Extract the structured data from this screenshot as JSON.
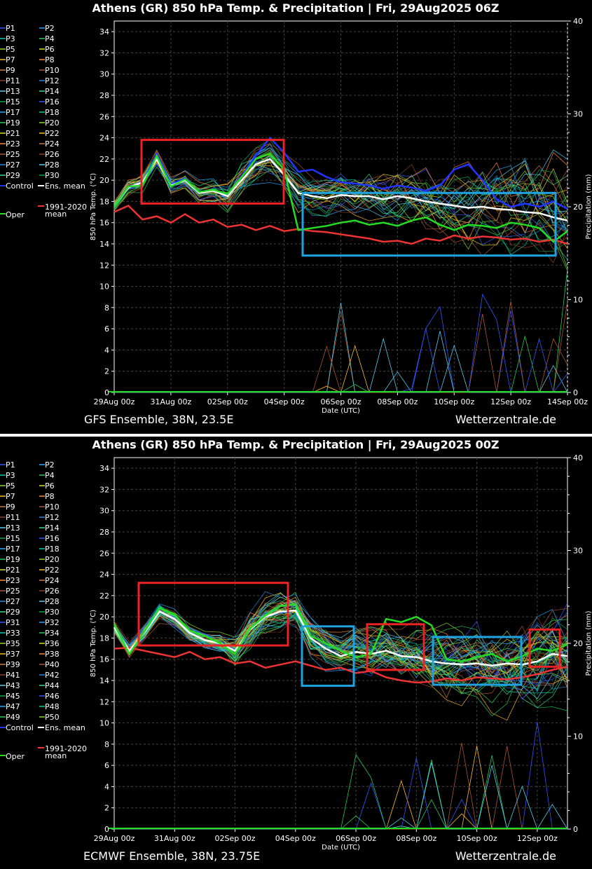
{
  "charts": [
    {
      "title": "Athens  (GR)  850 hPa Temp. & Precipitation | Fri, 29Aug2025 06Z",
      "footer_left": "GFS Ensemble, 38N, 23.5E",
      "footer_right": "Wetterzentrale.de",
      "members": 30,
      "legend_extra": [
        "Control",
        "Ens. mean",
        "1991-2020",
        "mean",
        "Oper"
      ],
      "ylabel": "850 hPa Temp. (°C)",
      "ylabel2": "Precipitation (mm)",
      "xlabel": "Date (UTC)",
      "x_ticks": [
        "29Aug 00z",
        "31Aug 00z",
        "02Sep 00z",
        "04Sep 00z",
        "06Sep 00z",
        "08Sep 00z",
        "10Sep 00z",
        "12Sep 00z",
        "14Sep 00z"
      ],
      "y_ticks": [
        0,
        2,
        4,
        6,
        8,
        10,
        12,
        14,
        16,
        18,
        20,
        22,
        24,
        26,
        28,
        30,
        32,
        34
      ],
      "y2_ticks": [
        0,
        10,
        20,
        30,
        40
      ],
      "ylim": [
        0,
        35
      ],
      "y2lim": [
        0,
        40
      ],
      "days_span": 16
    },
    {
      "title": "Athens  (GR)  850 hPa Temp. & Precipitation | Fri, 29Aug2025 00Z",
      "footer_left": "ECMWF Ensemble, 38N, 23.75E",
      "footer_right": "Wetterzentrale.de",
      "members": 50,
      "legend_extra": [
        "Control",
        "Ens. mean",
        "1991-2020",
        "mean",
        "Oper"
      ],
      "ylabel": "850 hPa Temp. (°C)",
      "ylabel2": "Precipitation (mm)",
      "xlabel": "Date (UTC)",
      "x_ticks": [
        "29Aug 00z",
        "31Aug 00z",
        "02Sep 00z",
        "04Sep 00z",
        "06Sep 00z",
        "08Sep 00z",
        "10Sep 00z",
        "12Sep 00z"
      ],
      "y_ticks": [
        0,
        2,
        4,
        6,
        8,
        10,
        12,
        14,
        16,
        18,
        20,
        22,
        24,
        26,
        28,
        30,
        32,
        34
      ],
      "y2_ticks": [
        0,
        10,
        20,
        30,
        40
      ],
      "ylim": [
        0,
        35
      ],
      "y2lim": [
        0,
        40
      ],
      "days_span": 15
    }
  ],
  "chart_data": [
    {
      "type": "line",
      "title": "Athens  (GR)  850 hPa Temp. & Precipitation | Fri, 29Aug2025 06Z",
      "xlabel": "Date (UTC)",
      "ylabel": "850 hPa Temp. (°C)",
      "ylim": [
        0,
        35
      ],
      "x": [
        "29Aug 00z",
        "29Aug 12z",
        "30Aug 00z",
        "30Aug 12z",
        "31Aug 00z",
        "31Aug 12z",
        "01Sep 00z",
        "01Sep 12z",
        "02Sep 00z",
        "02Sep 12z",
        "03Sep 00z",
        "03Sep 12z",
        "04Sep 00z",
        "04Sep 12z",
        "05Sep 00z",
        "05Sep 12z",
        "06Sep 00z",
        "06Sep 12z",
        "07Sep 00z",
        "07Sep 12z",
        "08Sep 00z",
        "08Sep 12z",
        "09Sep 00z",
        "09Sep 12z",
        "10Sep 00z",
        "10Sep 12z",
        "11Sep 00z",
        "11Sep 12z",
        "12Sep 00z",
        "12Sep 12z",
        "13Sep 00z",
        "13Sep 12z",
        "14Sep 00z"
      ],
      "series": [
        {
          "name": "Ens. mean",
          "color": "#ffffff",
          "values": [
            17.5,
            19.3,
            19.8,
            22.0,
            19.5,
            20.0,
            18.8,
            19.0,
            18.5,
            20.0,
            21.5,
            22.0,
            20.5,
            18.8,
            18.5,
            18.3,
            18.6,
            18.5,
            18.5,
            18.2,
            18.5,
            18.3,
            18.0,
            17.8,
            17.6,
            17.4,
            17.5,
            17.3,
            17.2,
            17.0,
            16.9,
            16.5,
            16.2
          ]
        },
        {
          "name": "Control",
          "color": "#2233ff",
          "values": [
            17.5,
            19.3,
            19.6,
            22.5,
            19.6,
            20.2,
            18.8,
            19.0,
            18.6,
            20.4,
            22.3,
            24.0,
            22.6,
            20.8,
            21.0,
            20.3,
            19.8,
            19.7,
            19.5,
            19.2,
            19.5,
            19.3,
            19.0,
            19.5,
            21.0,
            21.5,
            20.0,
            18.2,
            17.5,
            17.8,
            17.5,
            18.0,
            17.3
          ]
        },
        {
          "name": "1991-2020 mean",
          "color": "#ee3333",
          "values": [
            17.0,
            17.6,
            16.3,
            16.6,
            16.0,
            16.8,
            16.0,
            16.3,
            15.6,
            15.8,
            15.3,
            15.7,
            15.2,
            15.4,
            15.2,
            15.1,
            14.9,
            14.7,
            14.5,
            14.2,
            14.3,
            14.0,
            14.5,
            14.3,
            14.8,
            14.5,
            14.7,
            14.6,
            14.4,
            14.5,
            14.2,
            14.4,
            14.0
          ]
        },
        {
          "name": "Oper",
          "color": "#22dd22",
          "values": [
            17.5,
            19.4,
            19.5,
            22.3,
            19.4,
            20.1,
            18.9,
            19.1,
            18.7,
            20.3,
            22.0,
            22.5,
            21.0,
            15.3,
            15.5,
            15.7,
            16.0,
            16.2,
            15.8,
            16.0,
            15.7,
            16.2,
            16.5,
            15.8,
            15.3,
            15.8,
            15.7,
            15.5,
            16.0,
            15.8,
            15.5,
            14.2,
            15.2
          ]
        }
      ]
    },
    {
      "type": "line",
      "title": "Athens  (GR)  850 hPa Temp. & Precipitation | Fri, 29Aug2025 00Z",
      "xlabel": "Date (UTC)",
      "ylabel": "850 hPa Temp. (°C)",
      "ylim": [
        0,
        35
      ],
      "x": [
        "29Aug 00z",
        "29Aug 12z",
        "30Aug 00z",
        "30Aug 12z",
        "31Aug 00z",
        "31Aug 12z",
        "01Sep 00z",
        "01Sep 12z",
        "02Sep 00z",
        "02Sep 12z",
        "03Sep 00z",
        "03Sep 12z",
        "04Sep 00z",
        "04Sep 12z",
        "05Sep 00z",
        "05Sep 12z",
        "06Sep 00z",
        "06Sep 12z",
        "07Sep 00z",
        "07Sep 12z",
        "08Sep 00z",
        "08Sep 12z",
        "09Sep 00z",
        "09Sep 12z",
        "10Sep 00z",
        "10Sep 12z",
        "11Sep 00z",
        "11Sep 12z",
        "12Sep 00z",
        "12Sep 12z",
        "13Sep 00z"
      ],
      "series": [
        {
          "name": "Ens. mean",
          "color": "#ffffff",
          "values": [
            19.0,
            16.8,
            18.5,
            20.5,
            19.8,
            18.5,
            17.8,
            17.5,
            16.8,
            18.8,
            20.0,
            20.5,
            20.6,
            18.0,
            17.0,
            16.3,
            16.7,
            16.5,
            16.8,
            16.3,
            16.2,
            15.8,
            15.6,
            15.5,
            15.6,
            15.4,
            15.6,
            15.5,
            15.8,
            16.5,
            16.3
          ]
        },
        {
          "name": "1991-2020 mean",
          "color": "#ee3333",
          "values": [
            17.0,
            17.1,
            16.8,
            16.5,
            16.2,
            16.7,
            16.0,
            16.2,
            15.6,
            15.8,
            15.2,
            15.5,
            15.8,
            15.4,
            15.0,
            15.2,
            14.7,
            14.9,
            14.3,
            14.0,
            13.8,
            13.9,
            14.2,
            14.0,
            14.3,
            14.2,
            14.1,
            14.3,
            14.6,
            15.0,
            15.3
          ]
        },
        {
          "name": "Oper",
          "color": "#22dd22",
          "values": [
            19.3,
            16.5,
            18.6,
            20.8,
            20.2,
            18.7,
            18.2,
            17.5,
            16.5,
            18.9,
            20.1,
            21.0,
            21.2,
            18.2,
            17.5,
            16.8,
            16.2,
            16.5,
            19.8,
            19.5,
            20.0,
            19.2,
            16.0,
            15.8,
            16.2,
            16.5,
            15.8,
            16.3,
            17.0,
            16.8,
            17.4
          ]
        }
      ]
    }
  ]
}
